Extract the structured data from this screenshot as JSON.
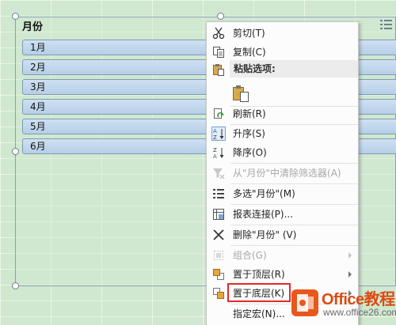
{
  "slicer": {
    "header": "月份",
    "items": [
      "1月",
      "2月",
      "3月",
      "4月",
      "5月",
      "6月"
    ]
  },
  "context_menu": {
    "items": [
      {
        "label": "剪切(T)",
        "icon": "scissors-icon",
        "enabled": true
      },
      {
        "label": "复制(C)",
        "icon": "copy-icon",
        "enabled": true
      },
      {
        "label": "粘贴选项:",
        "icon": "paste-icon",
        "enabled": true,
        "section_header": true
      },
      {
        "label": "",
        "icon": "paste-option-icon",
        "enabled": true
      },
      {
        "label": "刷新(R)",
        "icon": "refresh-icon",
        "enabled": true
      },
      {
        "label": "升序(S)",
        "icon": "sort-ascending-icon",
        "enabled": true
      },
      {
        "label": "降序(O)",
        "icon": "sort-descending-icon",
        "enabled": true
      },
      {
        "label": "从\"月份\"中清除筛选器(A)",
        "icon": "clear-filter-icon",
        "enabled": false
      },
      {
        "label": "多选\"月份\"(M)",
        "icon": "multi-select-icon",
        "enabled": true
      },
      {
        "label": "报表连接(P)...",
        "icon": "report-connections-icon",
        "enabled": true
      },
      {
        "label": "删除\"月份\" (V)",
        "icon": "delete-x-icon",
        "enabled": true
      },
      {
        "label": "组合(G)",
        "icon": "group-icon",
        "enabled": false,
        "submenu": true
      },
      {
        "label": "置于顶层(R)",
        "icon": "bring-to-front-icon",
        "enabled": true,
        "submenu": true
      },
      {
        "label": "置于底层(K)",
        "icon": "send-to-back-icon",
        "enabled": true,
        "submenu": true,
        "highlighted": true
      },
      {
        "label": "指定宏(N)...",
        "icon": "assign-macro-icon",
        "enabled": true
      }
    ]
  },
  "watermark": {
    "title": "Office教程网",
    "url": "www.office26.com"
  },
  "colors": {
    "sheet_bg": "#cfe8cf",
    "slicer_item": "#bcd3ea",
    "highlight_box": "#e22a2a",
    "watermark": "#e8581a"
  }
}
